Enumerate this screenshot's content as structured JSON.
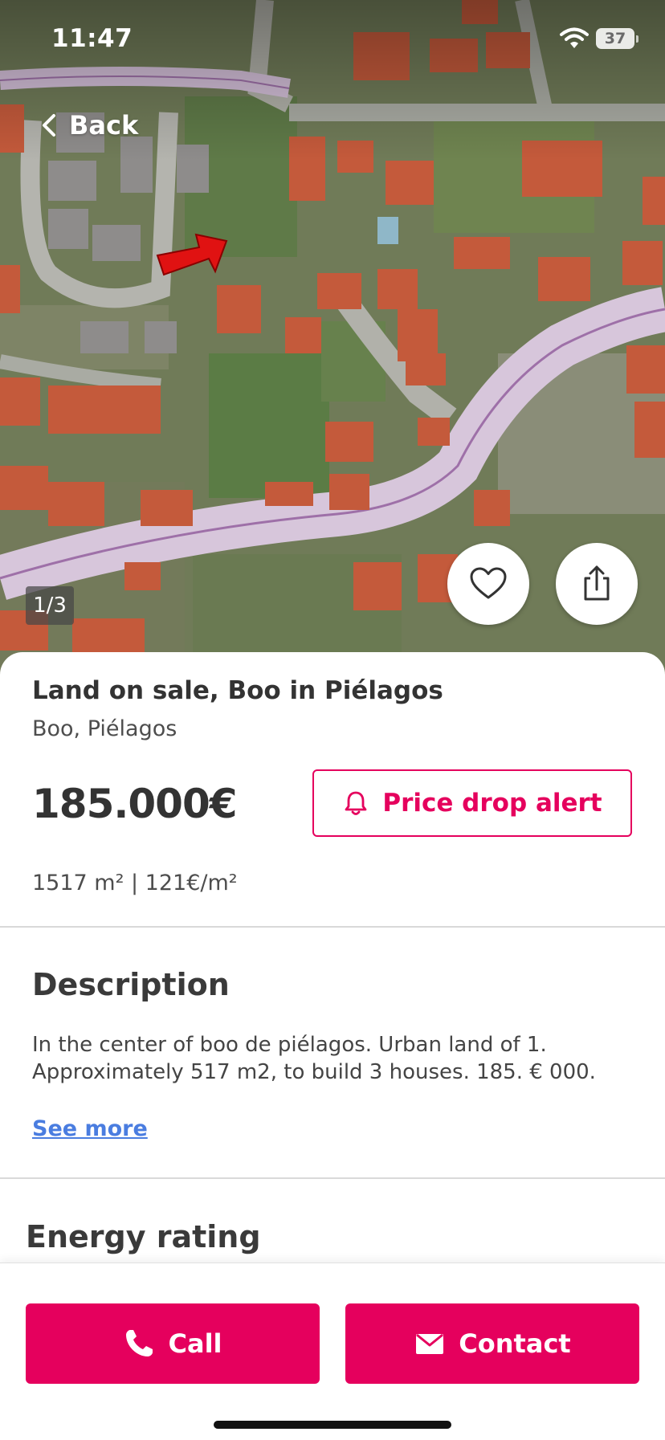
{
  "status_bar": {
    "time": "11:47",
    "battery": "37"
  },
  "nav": {
    "back_label": "Back"
  },
  "gallery": {
    "counter": "1/3"
  },
  "listing": {
    "title": "Land on sale, Boo in Piélagos",
    "location": "Boo, Piélagos",
    "price": "185.000€",
    "price_alert_label": "Price drop alert",
    "area_info": "1517 m² | 121€/m²"
  },
  "description": {
    "heading": "Description",
    "text": "In the center of boo de piélagos. Urban land of 1. Approximately 517 m2, to build 3 houses. 185. € 000.",
    "see_more": "See more"
  },
  "energy": {
    "heading": "Energy rating"
  },
  "actions": {
    "call_label": "Call",
    "contact_label": "Contact"
  },
  "colors": {
    "brand": "#e5005d",
    "link": "#4a7de0"
  }
}
